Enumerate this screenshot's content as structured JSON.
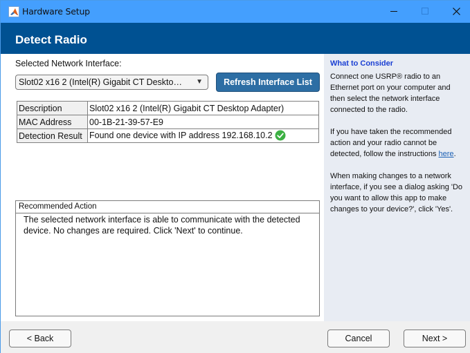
{
  "window": {
    "title": "Hardware Setup",
    "icon": "matlab-logo-icon",
    "controls": [
      "minimize",
      "maximize",
      "close"
    ]
  },
  "header": {
    "title": "Detect Radio"
  },
  "main": {
    "interface_label": "Selected Network Interface:",
    "interface_dropdown": {
      "selected": "Slot02 x16 2 (Intel(R) Gigabit CT Deskto…",
      "arrow": "▼"
    },
    "refresh_button": "Refresh Interface List",
    "info_table": [
      {
        "key": "Description",
        "value": "Slot02 x16 2 (Intel(R) Gigabit CT Desktop Adapter)"
      },
      {
        "key": "MAC Address",
        "value": "00-1B-21-39-57-E9"
      },
      {
        "key": "Detection Result",
        "value": "Found one device with IP address 192.168.10.2",
        "status_icon": "check-success-icon"
      }
    ],
    "recommended_action": {
      "title": "Recommended Action",
      "text": "The selected network interface is able to communicate with the detected device. No changes are required. Click 'Next' to continue."
    }
  },
  "sidebar": {
    "title": "What to Consider",
    "paragraphs": [
      "Connect one USRP® radio to an Ethernet port on your computer and then select the network interface connected to the radio.",
      "If you have taken the recommended action and your radio cannot be detected, follow the instructions ",
      "When making changes to a network interface, if you see a dialog asking 'Do you want to allow this app to make changes to your device?', click 'Yes'."
    ],
    "link_text": "here",
    "link_suffix": "."
  },
  "footer": {
    "back": "< Back",
    "cancel": "Cancel",
    "next": "Next >"
  },
  "colors": {
    "titlebar": "#449ffe",
    "header": "#005192",
    "accent_button": "#2d6ea4",
    "sidebar_bg": "#e8ecf3",
    "sidebar_title": "#1a3fd3",
    "success": "#3cb043"
  }
}
